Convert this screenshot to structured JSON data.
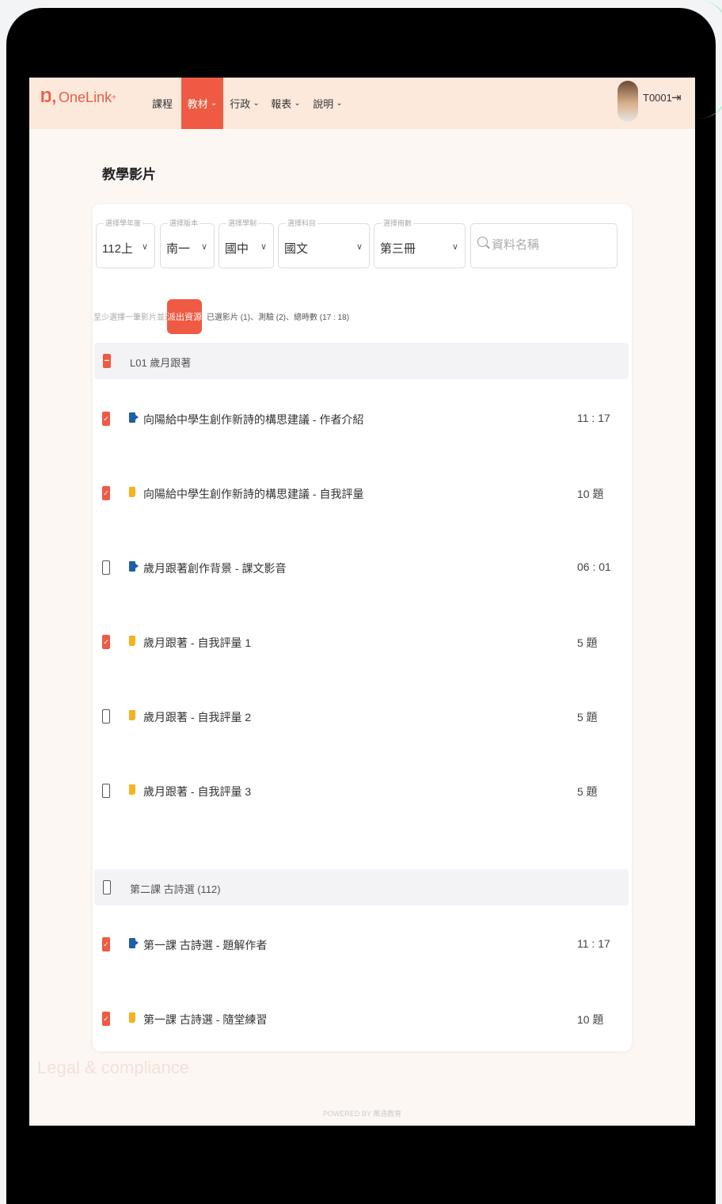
{
  "brand": {
    "name": "OneLink",
    "plus": "+"
  },
  "nav": [
    {
      "label": "課程",
      "has_menu": false,
      "active": false
    },
    {
      "label": "教材",
      "has_menu": true,
      "active": true
    },
    {
      "label": "行政",
      "has_menu": true,
      "active": false
    },
    {
      "label": "報表",
      "has_menu": true,
      "active": false
    },
    {
      "label": "說明",
      "has_menu": true,
      "active": false
    }
  ],
  "user": {
    "id": "T0001"
  },
  "page": {
    "title": "教學影片"
  },
  "filters": [
    {
      "label": "選擇學年度",
      "value": "112上"
    },
    {
      "label": "選擇版本",
      "value": "南一"
    },
    {
      "label": "選擇學制",
      "value": "國中"
    },
    {
      "label": "選擇科目",
      "value": "國文"
    },
    {
      "label": "選擇冊數",
      "value": "第三冊"
    }
  ],
  "search": {
    "placeholder": "資料名稱"
  },
  "actions": {
    "hint": "至少選擇一筆影片並進行：",
    "export_label": "派出資源",
    "selected_summary": "已選影片 (1)、測驗 (2)、總時數 (17 : 18)"
  },
  "groups": [
    {
      "title": "L01 歲月跟著",
      "state": "partial",
      "items": [
        {
          "type": "video",
          "checked": true,
          "title": "向陽給中學生創作新詩的構思建議 - 作者介紹",
          "meta": "11 : 17"
        },
        {
          "type": "quiz",
          "checked": true,
          "title": "向陽給中學生創作新詩的構思建議 - 自我評量",
          "meta": "10 題"
        },
        {
          "type": "video",
          "checked": false,
          "title": "歲月跟著創作背景 - 課文影音",
          "meta": "06 : 01"
        },
        {
          "type": "quiz",
          "checked": true,
          "title": "歲月跟著 - 自我評量 1",
          "meta": "5 題"
        },
        {
          "type": "quiz",
          "checked": false,
          "title": "歲月跟著 - 自我評量 2",
          "meta": "5 題"
        },
        {
          "type": "quiz",
          "checked": false,
          "title": "歲月跟著 - 自我評量 3",
          "meta": "5 題"
        }
      ]
    },
    {
      "title": "第二課 古詩選 (112)",
      "state": "unchecked",
      "items": [
        {
          "type": "video",
          "checked": true,
          "title": "第一課 古詩選 - 題解作者",
          "meta": "11 : 17"
        },
        {
          "type": "quiz",
          "checked": true,
          "title": "第一課 古詩選 - 隨堂練習",
          "meta": "10 題"
        }
      ]
    }
  ],
  "overlay_text": "Legal & compliance",
  "footer": {
    "powered": "POWERED BY 萬通教育"
  },
  "colors": {
    "accent": "#ee5a43",
    "nav_bg": "#fde8dc",
    "video_icon": "#1e5fa8",
    "quiz_icon": "#f4b322"
  }
}
